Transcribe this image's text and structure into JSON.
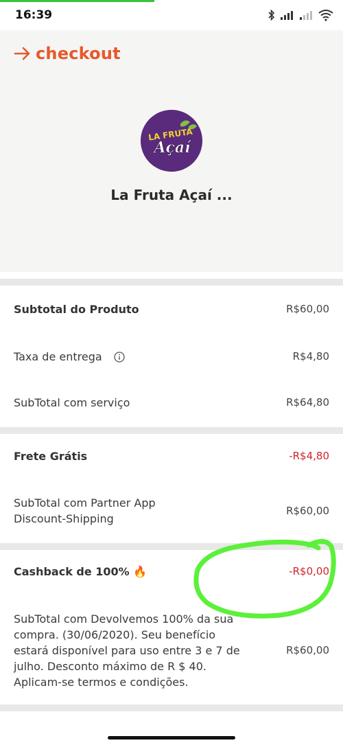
{
  "status_bar": {
    "time": "16:39",
    "progress_fraction": 0.45,
    "icons": [
      "bluetooth-icon",
      "signal-icon",
      "signal-weak-icon",
      "wifi-icon"
    ]
  },
  "header": {
    "title": "checkout",
    "accent_color": "#e8582a",
    "logo_text_top": "LA FRUTA",
    "logo_text_bottom": "Açaí",
    "store_name": "La Fruta Açaí ..."
  },
  "summary": {
    "subtotal_produto": {
      "label": "Subtotal do Produto",
      "value": "R$60,00"
    },
    "taxa_entrega": {
      "label": "Taxa de entrega",
      "value": "R$4,80"
    },
    "subtotal_servico": {
      "label": "SubTotal com serviço",
      "value": "R$64,80"
    },
    "frete_gratis": {
      "label": "Frete Grátis",
      "value": "-R$4,80"
    },
    "subtotal_partner": {
      "label": "SubTotal com Partner App Discount-Shipping",
      "value": "R$60,00"
    },
    "cashback": {
      "label": "Cashback de 100% 🔥",
      "value": "-R$0,00"
    },
    "subtotal_devolvemos": {
      "label": "SubTotal com Devolvemos 100% da sua compra. (30/06/2020). Seu benefício estará disponível para uso entre 3 e 7 de julho. Desconto máximo de R $ 40. Aplicam-se termos e condições.",
      "value": "R$60,00"
    }
  },
  "colors": {
    "negative": "#d0252a",
    "highlight_circle": "#5cf03a",
    "separator": "#e8e8e6"
  }
}
